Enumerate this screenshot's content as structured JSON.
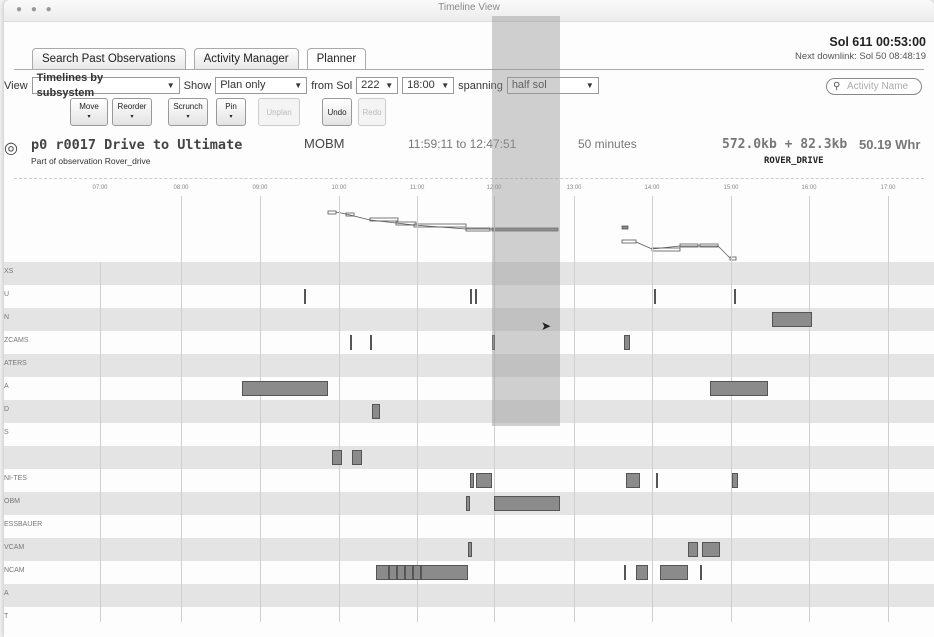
{
  "window": {
    "title": "Timeline View"
  },
  "tabs": [
    {
      "label": "Search Past Observations"
    },
    {
      "label": "Activity Manager"
    },
    {
      "label": "Planner"
    }
  ],
  "status": {
    "sol": "Sol 611 00:53:00",
    "downlink": "Next downlink: Sol 50 08:48:19"
  },
  "controls": {
    "view_label": "View",
    "view_value": "Timelines by subsystem",
    "show_label": "Show",
    "show_value": "Plan only",
    "from_label": "from Sol",
    "sol_value": "222",
    "time_value": "18:00",
    "spanning_label": "spanning",
    "spanning_value": "half sol",
    "search_placeholder": "Activity Name"
  },
  "toolbar": [
    {
      "label": "Move",
      "enabled": true
    },
    {
      "label": "Reorder",
      "enabled": true
    },
    {
      "label": "Scrunch",
      "enabled": true
    },
    {
      "label": "Pin",
      "enabled": true
    },
    {
      "label": "Unplan",
      "enabled": false
    },
    {
      "label": "Undo",
      "enabled": true
    },
    {
      "label": "Redo",
      "enabled": false
    }
  ],
  "activity": {
    "name": "p0 r0017  Drive to Ultimate",
    "subtitle": "Part of observation Rover_drive",
    "instrument": "MOBM",
    "time_range": "11:59:11 to 12:47:51",
    "duration": "50 minutes",
    "data_volume": "572.0kb + 82.3kb",
    "energy": "50.19 Whr",
    "observation": "ROVER_DRIVE"
  },
  "hours": [
    "07:00",
    "08:00",
    "09:00",
    "10:00",
    "11:00",
    "12:00",
    "13:00",
    "14:00",
    "15:00",
    "16:00",
    "17:00"
  ],
  "rows": [
    {
      "label": "XS"
    },
    {
      "label": "U"
    },
    {
      "label": "N"
    },
    {
      "label": "ZCAMS"
    },
    {
      "label": "ATERS"
    },
    {
      "label": "A"
    },
    {
      "label": "D"
    },
    {
      "label": "S"
    },
    {
      "label": ""
    },
    {
      "label": "NI-TES"
    },
    {
      "label": "OBM"
    },
    {
      "label": "ESSBAUER"
    },
    {
      "label": "VCAM"
    },
    {
      "label": "NCAM"
    },
    {
      "label": "A"
    },
    {
      "label": "T"
    }
  ]
}
